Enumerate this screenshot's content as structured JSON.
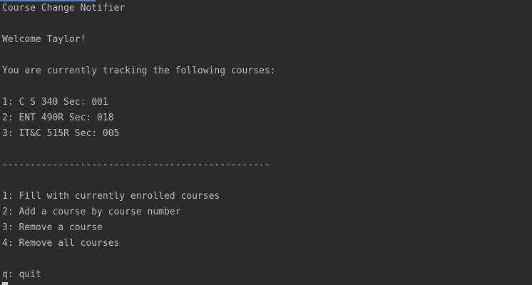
{
  "app": {
    "title": "Course Change Notifier",
    "welcome": "Welcome Taylor!"
  },
  "tracking": {
    "heading": "You are currently tracking the following courses:",
    "courses": [
      "1: C S 340 Sec: 001",
      "2: ENT 490R Sec: 018",
      "3: IT&C 515R Sec: 005"
    ]
  },
  "separator": "------------------------------------------------",
  "menu": {
    "options": [
      "1: Fill with currently enrolled courses",
      "2: Add a course by course number",
      "3: Remove a course",
      "4: Remove all courses"
    ],
    "quit": "q: quit"
  }
}
